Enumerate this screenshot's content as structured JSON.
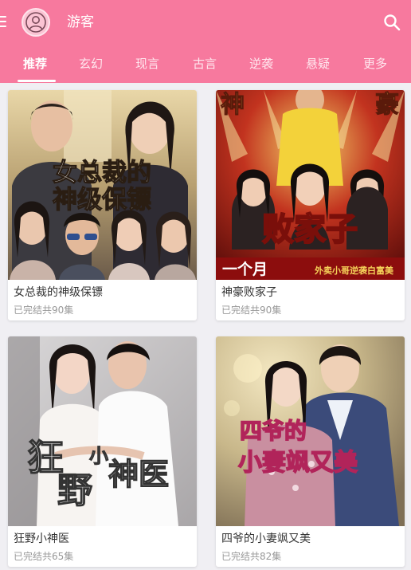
{
  "header": {
    "username": "游客",
    "avatar_icon": "user-icon",
    "menu_icon": "menu-icon",
    "search_icon": "search-icon",
    "background": "#f7799e"
  },
  "tabs": [
    {
      "label": "推荐",
      "active": true
    },
    {
      "label": "玄幻"
    },
    {
      "label": "现言"
    },
    {
      "label": "古言"
    },
    {
      "label": "逆袭"
    },
    {
      "label": "悬疑"
    },
    {
      "label": "更多"
    }
  ],
  "dramas": [
    {
      "title": "女总裁的神级保镖",
      "status": "已完结共90集",
      "poster_line1": "女总裁的",
      "poster_line2": "神级保镖"
    },
    {
      "title": "神豪败家子",
      "status": "已完结共90集",
      "poster_text": "败家子",
      "poster_banner": "一个月",
      "poster_sub": "外卖小哥逆袭白富美"
    },
    {
      "title": "狂野小神医",
      "status": "已完结共65集",
      "poster_line1": "狂",
      "poster_line1_small": "小",
      "poster_line2": "野",
      "poster_line2_rest": "神医"
    },
    {
      "title": "四爷的小妻飒又美",
      "status": "已完结共82集",
      "poster_line1": "四爷的",
      "poster_line2": "小妻飒又美"
    }
  ]
}
